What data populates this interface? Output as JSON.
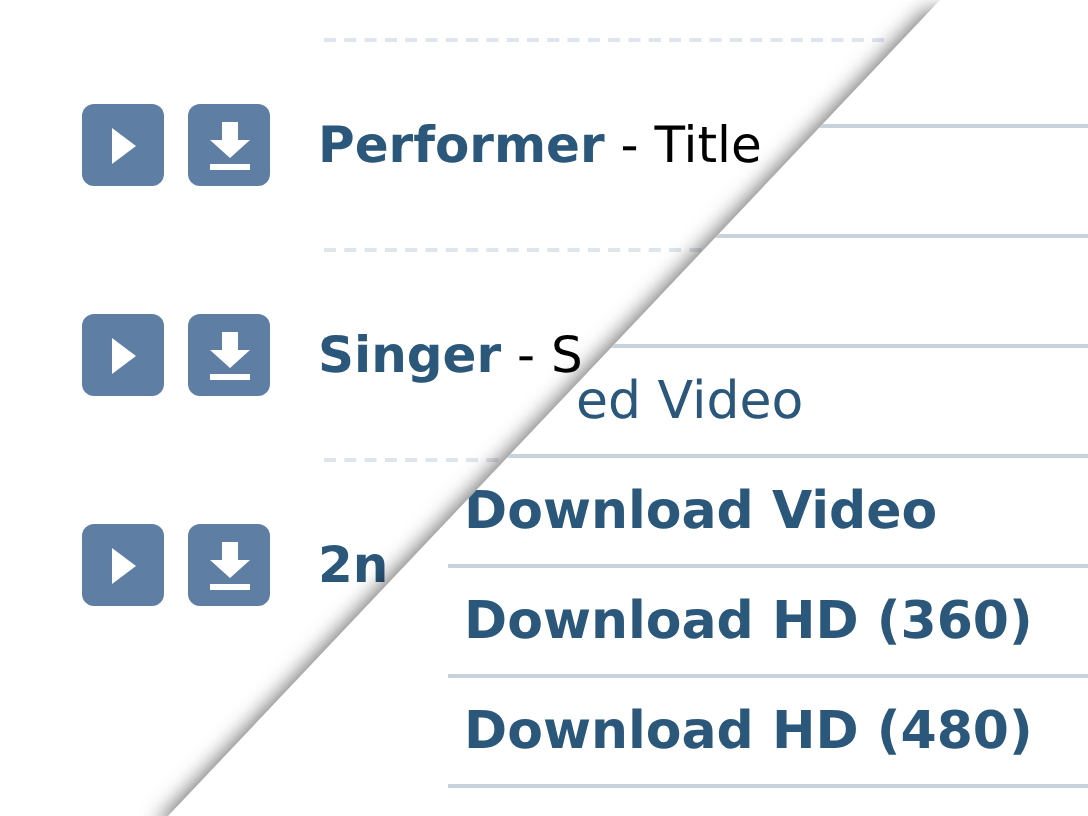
{
  "tracks": [
    {
      "label": "**Performer** - Title"
    },
    {
      "label": "**Singer** - S"
    },
    {
      "label": "**2n**"
    }
  ],
  "menu": {
    "items": [
      {
        "label": "ed Video",
        "kind": "plain"
      },
      {
        "label": "Download Video",
        "kind": "bold"
      },
      {
        "label": "Download HD (360)",
        "kind": "bold"
      },
      {
        "label": "Download HD (480)",
        "kind": "bold"
      }
    ]
  }
}
